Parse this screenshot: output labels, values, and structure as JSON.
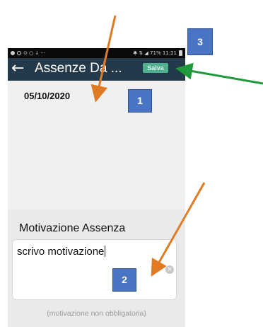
{
  "status_bar": {
    "left": "⊙ ○ ↓  ···",
    "right": "✱ ⇅ ◢ 71% 11:21"
  },
  "app_bar": {
    "back_icon": "arrow-left-icon",
    "title": "Assenze Da ...",
    "save_label": "Salva"
  },
  "date_section": {
    "date": "05/10/2020"
  },
  "reason_section": {
    "label": "Motivazione Assenza",
    "value": "scrivo motivazione",
    "clear_icon": "clear-x-icon",
    "hint": "(motivazione non obbligatoria)"
  },
  "annotations": {
    "badges": [
      "1",
      "2",
      "3"
    ],
    "colors": {
      "badge": "#4a74c4",
      "orange_arrow": "#e07b24",
      "green_arrow": "#1f9a3a"
    }
  },
  "colors": {
    "app_bar": "#243a4a",
    "save_button": "#4fb08f"
  }
}
